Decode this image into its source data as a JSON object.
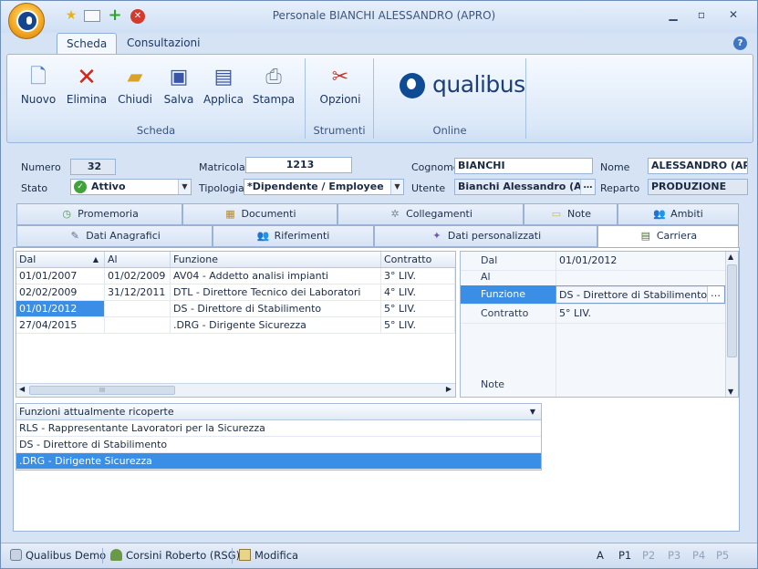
{
  "window": {
    "title": "Personale BIANCHI ALESSANDRO (APRO)"
  },
  "ribbon_tabs": [
    "Scheda",
    "Consultazioni"
  ],
  "ribbon": {
    "scheda_buttons": [
      "Nuovo",
      "Elimina",
      "Chiudi",
      "Salva",
      "Applica",
      "Stampa"
    ],
    "scheda_group": "Scheda",
    "strumenti_button": "Opzioni",
    "strumenti_group": "Strumenti",
    "online_logo": "qualibus",
    "online_group": "Online"
  },
  "form": {
    "numero_label": "Numero",
    "numero": "32",
    "matricola_label": "Matricola",
    "matricola": "1213",
    "cognome_label": "Cognome",
    "cognome": "BIANCHI",
    "nome_label": "Nome",
    "nome": "ALESSANDRO (AP",
    "stato_label": "Stato",
    "stato": "Attivo",
    "tipologia_label": "Tipologia",
    "tipologia": "*Dipendente / Employee",
    "utente_label": "Utente",
    "utente": "Bianchi Alessandro (API",
    "reparto_label": "Reparto",
    "reparto": "PRODUZIONE"
  },
  "tabs_row1": [
    "Promemoria",
    "Documenti",
    "Collegamenti",
    "Note",
    "Ambiti"
  ],
  "tabs_row2": [
    "Dati Anagrafici",
    "Riferimenti",
    "Dati personalizzati",
    "Carriera"
  ],
  "career_grid": {
    "headers": [
      "Dal",
      "Al",
      "Funzione",
      "Contratto"
    ],
    "rows": [
      [
        "01/01/2007",
        "01/02/2009",
        "AV04 - Addetto analisi impianti",
        "3° LIV."
      ],
      [
        "02/02/2009",
        "31/12/2011",
        "DTL - Direttore Tecnico dei Laboratori",
        "4° LIV."
      ],
      [
        "01/01/2012",
        "",
        "DS - Direttore di Stabilimento",
        "5° LIV."
      ],
      [
        "27/04/2015",
        "",
        ".DRG - Dirigente Sicurezza",
        "5° LIV."
      ]
    ],
    "scroll_marker": "III"
  },
  "details": {
    "rows": [
      {
        "label": "Dal",
        "value": "01/01/2012"
      },
      {
        "label": "Al",
        "value": ""
      },
      {
        "label": "Funzione",
        "value": "DS - Direttore di Stabilimento"
      },
      {
        "label": "Contratto",
        "value": "5° LIV."
      }
    ],
    "note_label": "Note",
    "ellipsis": "…"
  },
  "functions_list": {
    "header": "Funzioni attualmente ricoperte",
    "items": [
      "RLS - Rappresentante Lavoratori per la Sicurezza",
      "DS - Direttore di Stabilimento",
      ".DRG - Dirigente Sicurezza"
    ]
  },
  "status": {
    "db": "Qualibus Demo",
    "user": "Corsini Roberto (RSG)",
    "mode": "Modifica",
    "pages": [
      "A",
      "P1",
      "P2",
      "P3",
      "P4",
      "P5"
    ]
  },
  "colors": {
    "accent": "#3a8ee6",
    "ribbon": "#dbe8f8",
    "frame": "#d5e3f5"
  }
}
